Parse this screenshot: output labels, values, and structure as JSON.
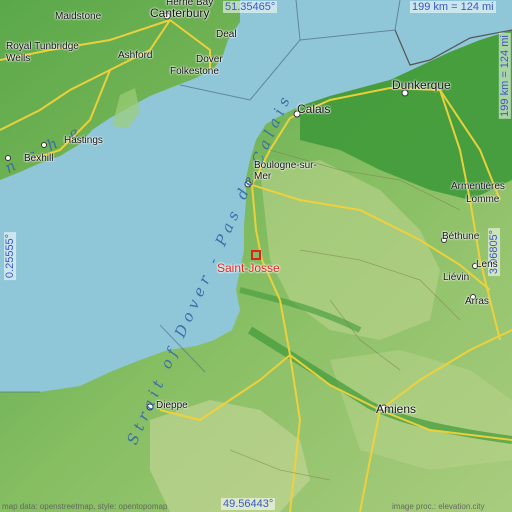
{
  "map": {
    "colors": {
      "sea": "#8fc7d8",
      "land_low": "#3f9a3a",
      "land_mid": "#8cc36a",
      "land_high": "#c8d79a",
      "road": "#f2d23a",
      "border": "#555555",
      "marker": "#e0221e",
      "coord": "#3a58c8"
    },
    "coordinates": {
      "top_lat": "51.35465°",
      "bottom_lat": "49.56443°",
      "left_lon": "0.25555°",
      "right_lon": "3.06805°"
    },
    "scale": {
      "horizontal": "199 km = 124 mi",
      "vertical": "199 km = 124 mi"
    },
    "sea_labels": {
      "strait": "Strait of Dover - Pas de Calais",
      "manche": "n c h e"
    },
    "marker": {
      "name": "Saint-Josse",
      "icon": "square-marker-icon"
    },
    "cities": [
      {
        "id": "canterbury",
        "name": "Canterbury",
        "big": true
      },
      {
        "id": "maidstone",
        "name": "Maidstone",
        "big": false
      },
      {
        "id": "herne-bay",
        "name": "Herne Bay",
        "big": false
      },
      {
        "id": "ashford",
        "name": "Ashford",
        "big": false
      },
      {
        "id": "royal-tunbridge",
        "name": "Royal Tunbridge",
        "big": false
      },
      {
        "id": "wells",
        "name": "Wells",
        "big": false
      },
      {
        "id": "dover",
        "name": "Dover",
        "big": false
      },
      {
        "id": "deal",
        "name": "Deal",
        "big": false
      },
      {
        "id": "folkestone",
        "name": "Folkestone",
        "big": false
      },
      {
        "id": "hastings",
        "name": "Hastings",
        "big": false
      },
      {
        "id": "bexhill",
        "name": "Bexhill",
        "big": false
      },
      {
        "id": "calais",
        "name": "Calais",
        "big": true
      },
      {
        "id": "dunkerque",
        "name": "Dunkerque",
        "big": true
      },
      {
        "id": "boulogne",
        "name": "Boulogne-sur-",
        "big": false
      },
      {
        "id": "boulogne2",
        "name": "Mer",
        "big": false
      },
      {
        "id": "armentieres",
        "name": "Armentières",
        "big": false
      },
      {
        "id": "lomme",
        "name": "Lomme",
        "big": false
      },
      {
        "id": "bethune",
        "name": "Béthune",
        "big": false
      },
      {
        "id": "lens",
        "name": "Lens",
        "big": false
      },
      {
        "id": "lievin",
        "name": "Liévin",
        "big": false
      },
      {
        "id": "arras",
        "name": "Arras",
        "big": false
      },
      {
        "id": "amiens",
        "name": "Amiens",
        "big": true
      },
      {
        "id": "dieppe",
        "name": "Dieppe",
        "big": false
      }
    ],
    "attribution_left": "map data: openstreetmap, style: opentopomap",
    "attribution_right": "image proc.: elevation.city"
  }
}
